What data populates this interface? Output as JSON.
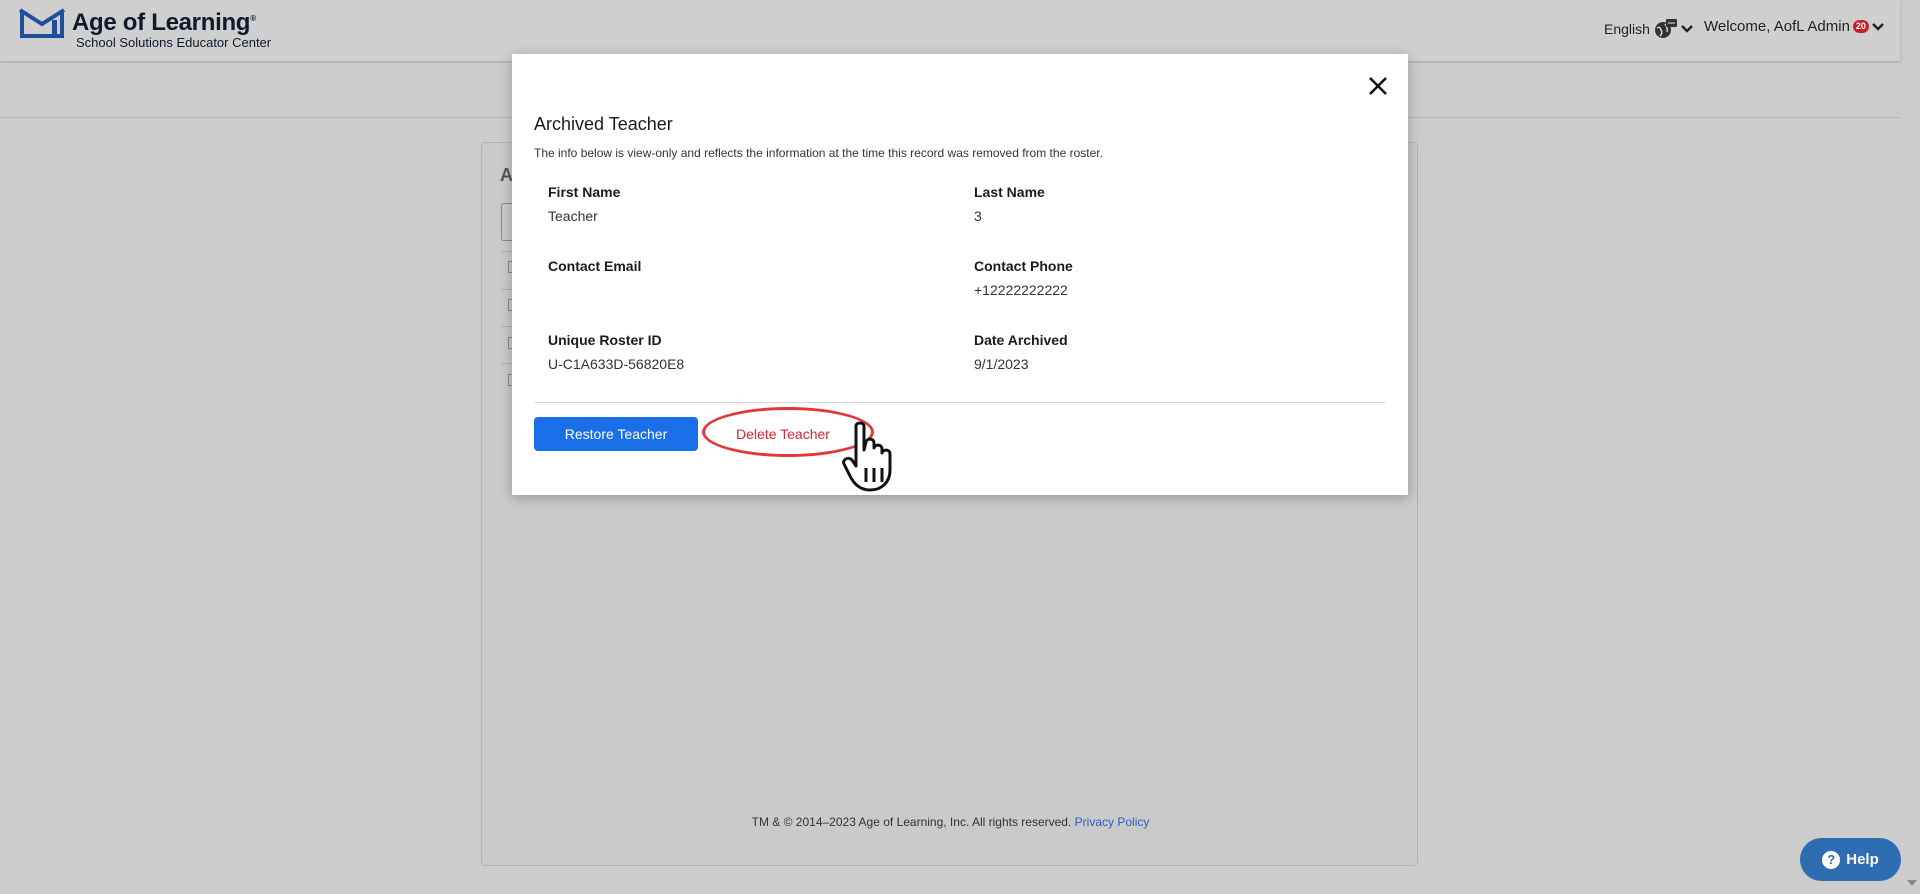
{
  "header": {
    "brand": "Age of Learning",
    "brand_mark": "®",
    "tagline": "School Solutions Educator Center",
    "language": "English",
    "welcome": "Welcome, AofL Admin",
    "notification_count": "20"
  },
  "panel": {
    "title_fragment": "A",
    "footer_text": "TM & © 2014–2023 Age of Learning, Inc. All rights reserved.",
    "privacy_link": "Privacy Policy"
  },
  "modal": {
    "title": "Archived Teacher",
    "description": "The info below is view-only and reflects the information at the time this record was removed from the roster.",
    "fields": [
      {
        "label": "First Name",
        "value": "Teacher"
      },
      {
        "label": "Last Name",
        "value": "3"
      },
      {
        "label": "Contact Email",
        "value": ""
      },
      {
        "label": "Contact Phone",
        "value": "+12222222222"
      },
      {
        "label": "Unique Roster ID",
        "value": "U-C1A633D-56820E8"
      },
      {
        "label": "Date Archived",
        "value": "9/1/2023"
      }
    ],
    "restore_label": "Restore Teacher",
    "delete_label": "Delete Teacher"
  },
  "help": {
    "label": "Help",
    "icon": "?"
  },
  "colors": {
    "primary_button": "#1a6fe8",
    "danger_text": "#d6272f",
    "badge": "#c6202a",
    "help_button": "#2f6db2"
  }
}
